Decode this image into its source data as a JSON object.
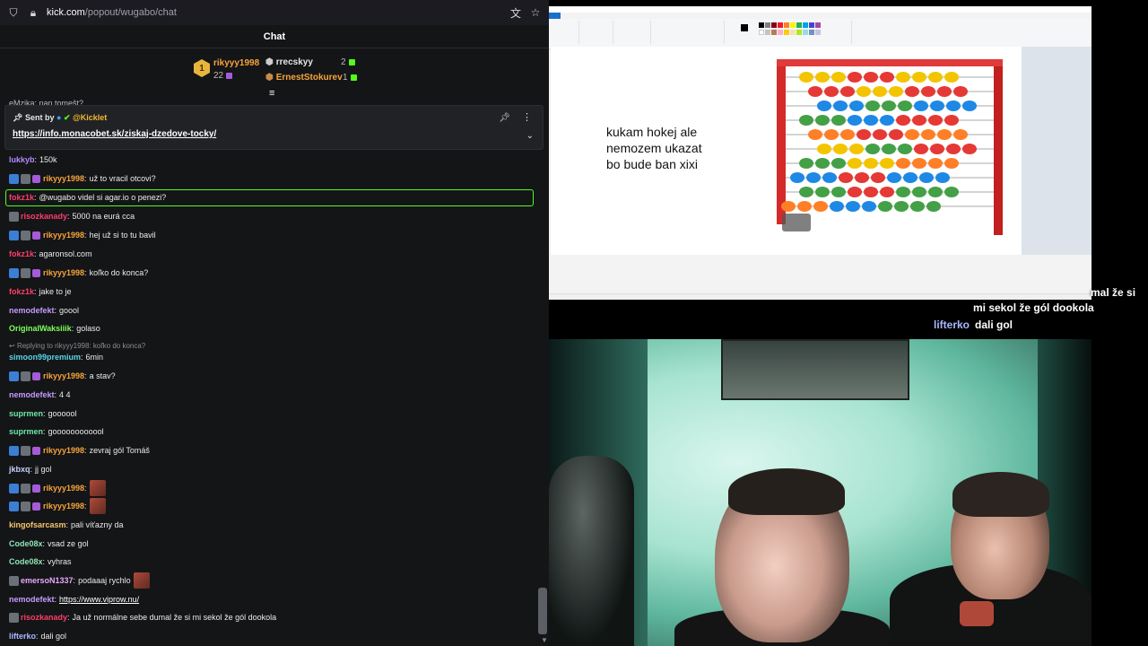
{
  "browser": {
    "url_host": "kick.com",
    "url_path": "/popout/wugabo/chat"
  },
  "chat": {
    "title": "Chat",
    "leaderboard": {
      "top": {
        "rank": "1",
        "name": "rikyyy1998",
        "count": "22"
      },
      "second": {
        "name": "rrecskyy",
        "count": "2"
      },
      "third": {
        "name": "ErnestStokurev",
        "count": "1"
      }
    },
    "cut_message": "eMzika: nan tomešt?",
    "pinned": {
      "sent_by_label": "Sent by",
      "sent_by_user": "@Kicklet",
      "link": "https://info.monacobet.sk/ziskaj-dzedove-tocky/"
    },
    "reply_context": "Replying to rikyyy1998: koľko do konca?",
    "messages": [
      {
        "user": "lukkyb",
        "color": "#b38bff",
        "text": "150k",
        "badges": []
      },
      {
        "user": "rikyyy1998",
        "color": "#f7a43c",
        "text": "už to vracil otcovi?",
        "badges": [
          "blue",
          "grey",
          "purple"
        ]
      },
      {
        "user": "fokz1k",
        "color": "#ff3d6b",
        "text": "@wugabo videl si agar.io o penezi?",
        "badges": []
      },
      {
        "user": "risozkanady",
        "color": "#ff3d6b",
        "text": "5000 na eurá cca",
        "badges": [
          "grey"
        ]
      },
      {
        "user": "rikyyy1998",
        "color": "#f7a43c",
        "text": "hej už si to tu bavil",
        "badges": [
          "blue",
          "grey",
          "purple"
        ]
      },
      {
        "user": "fokz1k",
        "color": "#ff3d6b",
        "text": "agaronsol.com",
        "badges": []
      },
      {
        "user": "rikyyy1998",
        "color": "#f7a43c",
        "text": "koľko do konca?",
        "badges": [
          "blue",
          "grey",
          "purple"
        ]
      },
      {
        "user": "fokz1k",
        "color": "#ff3d6b",
        "text": "jake to je",
        "badges": []
      },
      {
        "user": "nemodefekt",
        "color": "#c49bff",
        "text": "goool",
        "badges": []
      },
      {
        "user": "OriginalWaksiiik",
        "color": "#7dff5a",
        "text": "golaso",
        "badges": []
      },
      {
        "user": "simoon99premium",
        "color": "#5ad4e6",
        "text": "6min",
        "badges": []
      },
      {
        "user": "rikyyy1998",
        "color": "#f7a43c",
        "text": "a stav?",
        "badges": [
          "blue",
          "grey",
          "purple"
        ]
      },
      {
        "user": "nemodefekt",
        "color": "#c49bff",
        "text": "4 4",
        "badges": []
      },
      {
        "user": "suprmen",
        "color": "#6ee7a8",
        "text": "goooool",
        "badges": []
      },
      {
        "user": "suprmen",
        "color": "#6ee7a8",
        "text": "goooooooooool",
        "badges": []
      },
      {
        "user": "rikyyy1998",
        "color": "#f7a43c",
        "text": "zevraj gól Tomáš",
        "badges": [
          "blue",
          "grey",
          "purple"
        ]
      },
      {
        "user": "jkbxq",
        "color": "#c9d1ff",
        "text": "jj gol",
        "badges": []
      },
      {
        "user": "rikyyy1998",
        "color": "#f7a43c",
        "text": "",
        "badges": [
          "blue",
          "grey",
          "purple"
        ],
        "emote": true
      },
      {
        "user": "rikyyy1998",
        "color": "#f7a43c",
        "text": "",
        "badges": [
          "blue",
          "grey",
          "purple"
        ],
        "emote": true
      },
      {
        "user": "kingofsarcasm",
        "color": "#f7c56a",
        "text": "pali víťazny da",
        "badges": []
      },
      {
        "user": "Code08x",
        "color": "#8fe3b5",
        "text": "vsad ze gol",
        "badges": []
      },
      {
        "user": "Code08x",
        "color": "#8fe3b5",
        "text": "vyhras",
        "badges": []
      },
      {
        "user": "emersoN1337",
        "color": "#e9a6ff",
        "text": "podaaaj rychlo",
        "badges": [
          "grey"
        ],
        "emote_after": true
      },
      {
        "user": "nemodefekt",
        "color": "#c49bff",
        "text": "https://www.viprow.nu/",
        "badges": [],
        "link": true
      },
      {
        "user": "risozkanady",
        "color": "#ff3d6b",
        "text": "Ja už normálne sebe dumal že si mi sekol že gól dookola",
        "badges": [
          "grey"
        ]
      },
      {
        "user": "lifterko",
        "color": "#a9b8ff",
        "text": "dali gol",
        "badges": []
      }
    ]
  },
  "paint": {
    "canvas_text_lines": [
      "kukam hokej ale",
      "nemozem ukazat",
      "bo bude ban xixi"
    ]
  },
  "overlay": {
    "line1": "mal že si",
    "line2": "mi sekol že gól dookola",
    "line3_user": "lifterko",
    "line3_text": "dali gol"
  },
  "colors": {
    "kick_green": "#53fc18",
    "chat_bg": "#141517"
  }
}
